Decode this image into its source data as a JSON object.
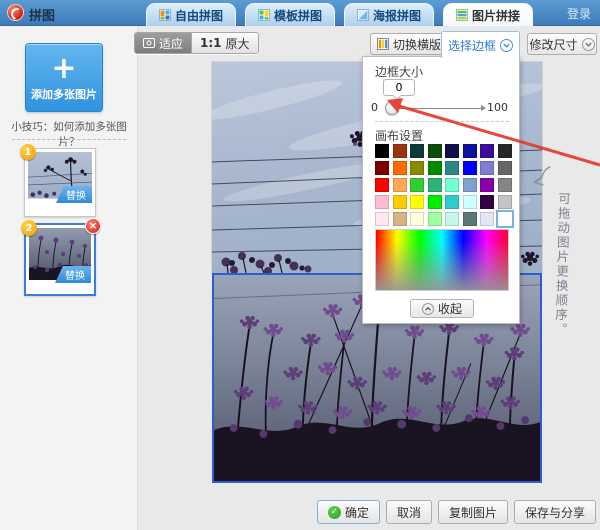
{
  "app": {
    "title": "拼图",
    "login_label": "登录"
  },
  "tabs": [
    {
      "label": "自由拼图",
      "active": false
    },
    {
      "label": "模板拼图",
      "active": false
    },
    {
      "label": "海报拼图",
      "active": false
    },
    {
      "label": "图片拼接",
      "active": true
    }
  ],
  "sidebar": {
    "add_button_label": "添加多张图片",
    "tip_text": "小技巧：如何添加多张图片？",
    "thumbnails": [
      {
        "index": "1",
        "replace_label": "替换",
        "removable": false
      },
      {
        "index": "2",
        "replace_label": "替换",
        "removable": true,
        "selected": true
      }
    ]
  },
  "toolbar": {
    "fit_label": "适应",
    "ratio_text": "1:1",
    "original_label": "原大",
    "switch_layout_label": "切换横版",
    "select_border_label": "选择边框",
    "resize_label": "修改尺寸"
  },
  "border_panel": {
    "size_label": "边框大小",
    "size_value": "0",
    "slider_min": "0",
    "slider_max": "100",
    "slider_position": 0,
    "canvas_label": "画布设置",
    "collapse_label": "收起",
    "selected_index": 39,
    "selected_color": "#ffffff",
    "palette": [
      "#000000",
      "#9a3312",
      "#0d3a3a",
      "#0b4d0b",
      "#10104d",
      "#10109e",
      "#3a0d9e",
      "#282828",
      "#7a0000",
      "#ff6a00",
      "#8a8a00",
      "#008a00",
      "#2e8585",
      "#0000ff",
      "#7d7dd6",
      "#666666",
      "#ff0000",
      "#ffaa55",
      "#33cc33",
      "#2eb377",
      "#70ffd0",
      "#7da3cc",
      "#8800aa",
      "#858585",
      "#ffbcd0",
      "#ffcc00",
      "#ffff00",
      "#00ee00",
      "#2ecccc",
      "#ccffff",
      "#320446",
      "#c4c4c4",
      "#ffe8ef",
      "#d6b384",
      "#ffffdd",
      "#a0ffa0",
      "#c6f7e6",
      "#5a7878",
      "#e4e4f6",
      "#ffffff"
    ]
  },
  "annotation": {
    "note_text": "可拖动图片更换顺序。"
  },
  "footer": {
    "confirm_label": "确定",
    "cancel_label": "取消",
    "copy_label": "复制图片",
    "save_share_label": "保存与分享"
  },
  "colors": {
    "topbar_blue": "#4a8cc6",
    "accent_blue": "#2e7cd0",
    "selection_blue": "#2b5ece",
    "add_button_blue": "#2f93de",
    "badge_orange": "#f59f00",
    "delete_red": "#d42121",
    "arrow_red": "#e4392b"
  }
}
